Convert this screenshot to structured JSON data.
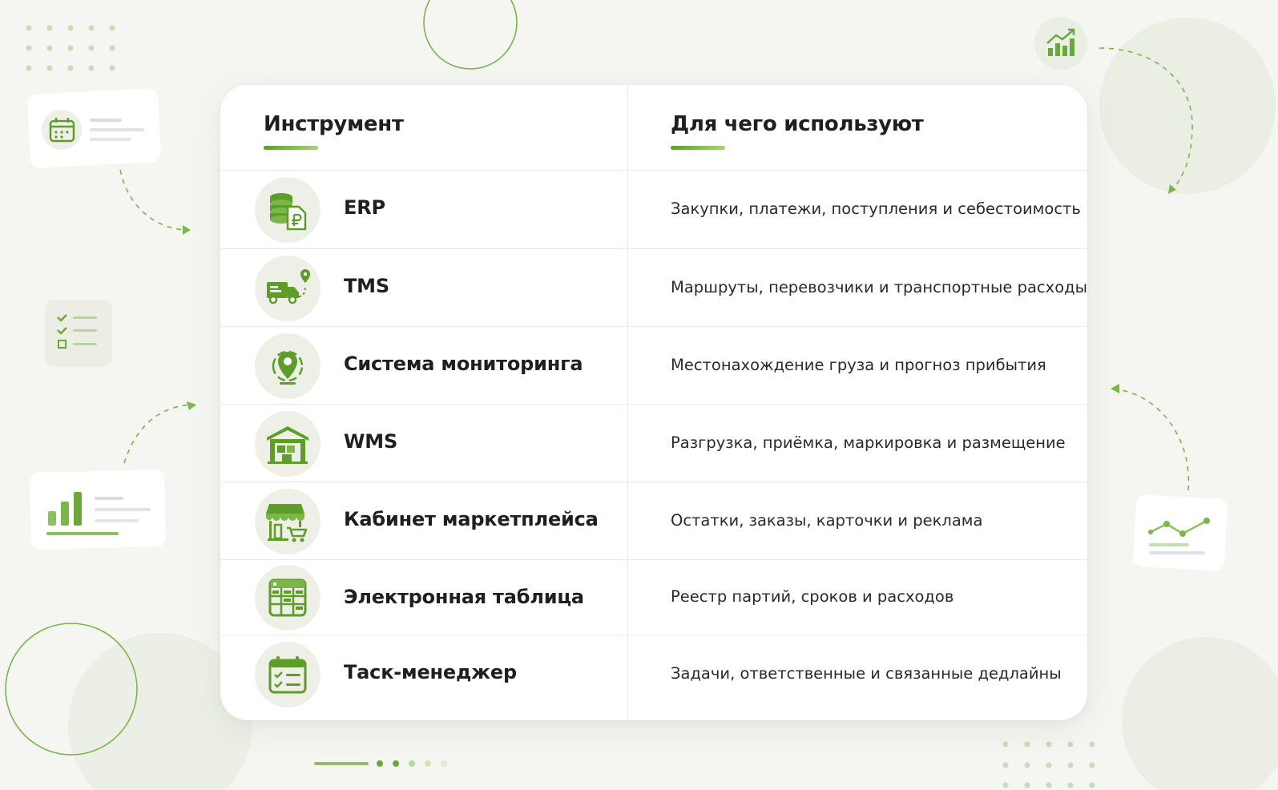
{
  "colors": {
    "accent": "#5e9d2a",
    "accent_light": "#a8d27a",
    "icon_bg": "#eef0e8",
    "background": "#f5f5f1"
  },
  "table": {
    "header": {
      "tool": "Инструмент",
      "purpose": "Для чего используют"
    },
    "rows": [
      {
        "icon": "database-ruble-document-icon",
        "tool": "ERP",
        "purpose": "Закупки, платежи, поступления и себестоимость"
      },
      {
        "icon": "delivery-truck-route-icon",
        "tool": "TMS",
        "purpose": "Маршруты, перевозчики и транспортные расходы"
      },
      {
        "icon": "location-pin-monitoring-icon",
        "tool": "Система мониторинга",
        "purpose": "Местонахождение груза и прогноз прибытия"
      },
      {
        "icon": "warehouse-icon",
        "tool": "WMS",
        "purpose": "Разгрузка, приёмка, маркировка и размещение"
      },
      {
        "icon": "marketplace-store-cart-icon",
        "tool": "Кабинет маркетплейса",
        "purpose": "Остатки, заказы, карточки и реклама"
      },
      {
        "icon": "spreadsheet-icon",
        "tool": "Электронная таблица",
        "purpose": "Реестр партий, сроков и расходов"
      },
      {
        "icon": "task-calendar-checklist-icon",
        "tool": "Таск-менеджер",
        "purpose": "Задачи, ответственные и связанные дедлайны"
      }
    ]
  },
  "decorations": [
    "calendar-card-icon",
    "checklist-card-icon",
    "bar-chart-card-icon",
    "growth-chart-icon",
    "line-chart-card-icon"
  ]
}
